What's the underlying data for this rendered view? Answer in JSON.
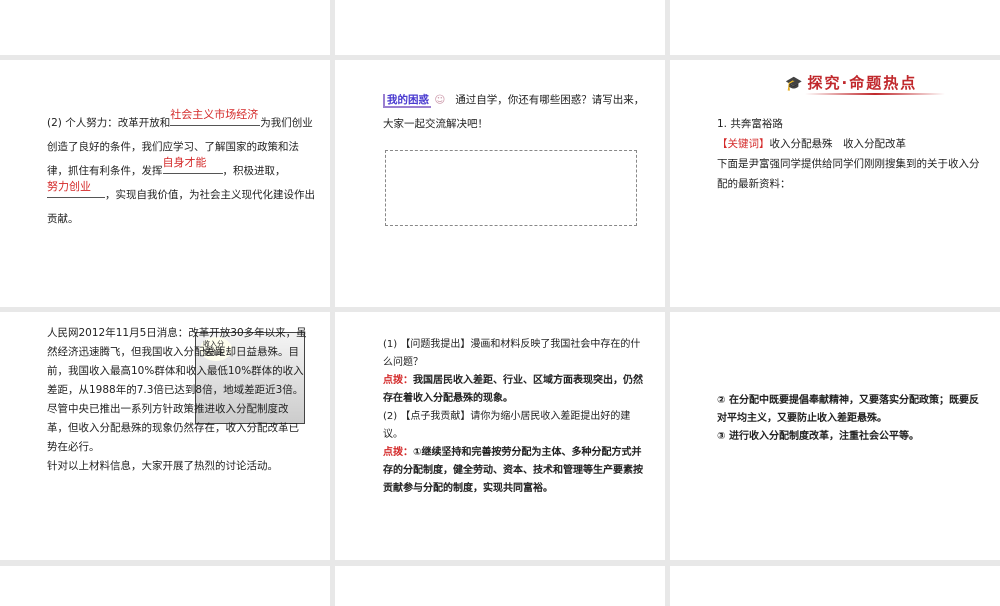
{
  "slide2": {
    "prefix": "(2) 个人努力：改革开放和",
    "blank1": "社会主义市场经济",
    "t1": "为我们创业创造了良好的条件，我们应学习、了解国家的政策和法律，抓住有利条件，发挥",
    "blank2": "自身才能",
    "t2": "，积极进取，",
    "blank3": "努力创业",
    "t3": "，实现自我价值，为社会主义现代化建设作出贡献。"
  },
  "slide3": {
    "tag": "我的困惑",
    "text": "通过自学，你还有哪些困惑？请写出来，大家一起交流解决吧！"
  },
  "slide4": {
    "banner": "探究·命题热点",
    "heading": "1. 共奔富裕路",
    "keyword_label": "【关键词】",
    "keywords": "收入分配悬殊　收入分配改革",
    "body": "下面是尹富强同学提供给同学们刚刚搜集到的关于收入分配的最新资料："
  },
  "slide5": {
    "text": "人民网2012年11月5日消息：改革开放30多年以来，虽然经济迅速腾飞，但我国收入分配差距却日益悬殊。目前，我国收入最高10%群体和收入最低10%群体的收入差距，从1988年的7.3倍已达到8倍，地域差距近3倍。尽管中央已推出一系列方针政策推进收入分配制度改革，但收入分配悬殊的现象仍然存在，收入分配改革已势在必行。",
    "closing": "针对以上材料信息，大家开展了热烈的讨论活动。",
    "cartoon_label": "收入分配改革"
  },
  "slide6": {
    "q1_prefix": "(1)",
    "q1_tag": "【问题我提出】",
    "q1": "漫画和材料反映了我国社会中存在的什么问题？",
    "hint_label": "点拨：",
    "a1": "我国居民收入差距、行业、区域方面表现突出，仍然存在着收入分配悬殊的现象。",
    "q2_prefix": "(2)",
    "q2_tag": "【点子我贡献】",
    "q2": "请你为缩小居民收入差距提出好的建议。",
    "a2": "①继续坚持和完善按劳分配为主体、多种分配方式并存的分配制度，健全劳动、资本、技术和管理等生产要素按贡献参与分配的制度，实现共同富裕。"
  },
  "slide7": {
    "p2": "② 在分配中既要提倡奉献精神，又要落实分配政策；既要反对平均主义，又要防止收入差距悬殊。",
    "p3": "③ 进行收入分配制度改革，注重社会公平等。"
  }
}
